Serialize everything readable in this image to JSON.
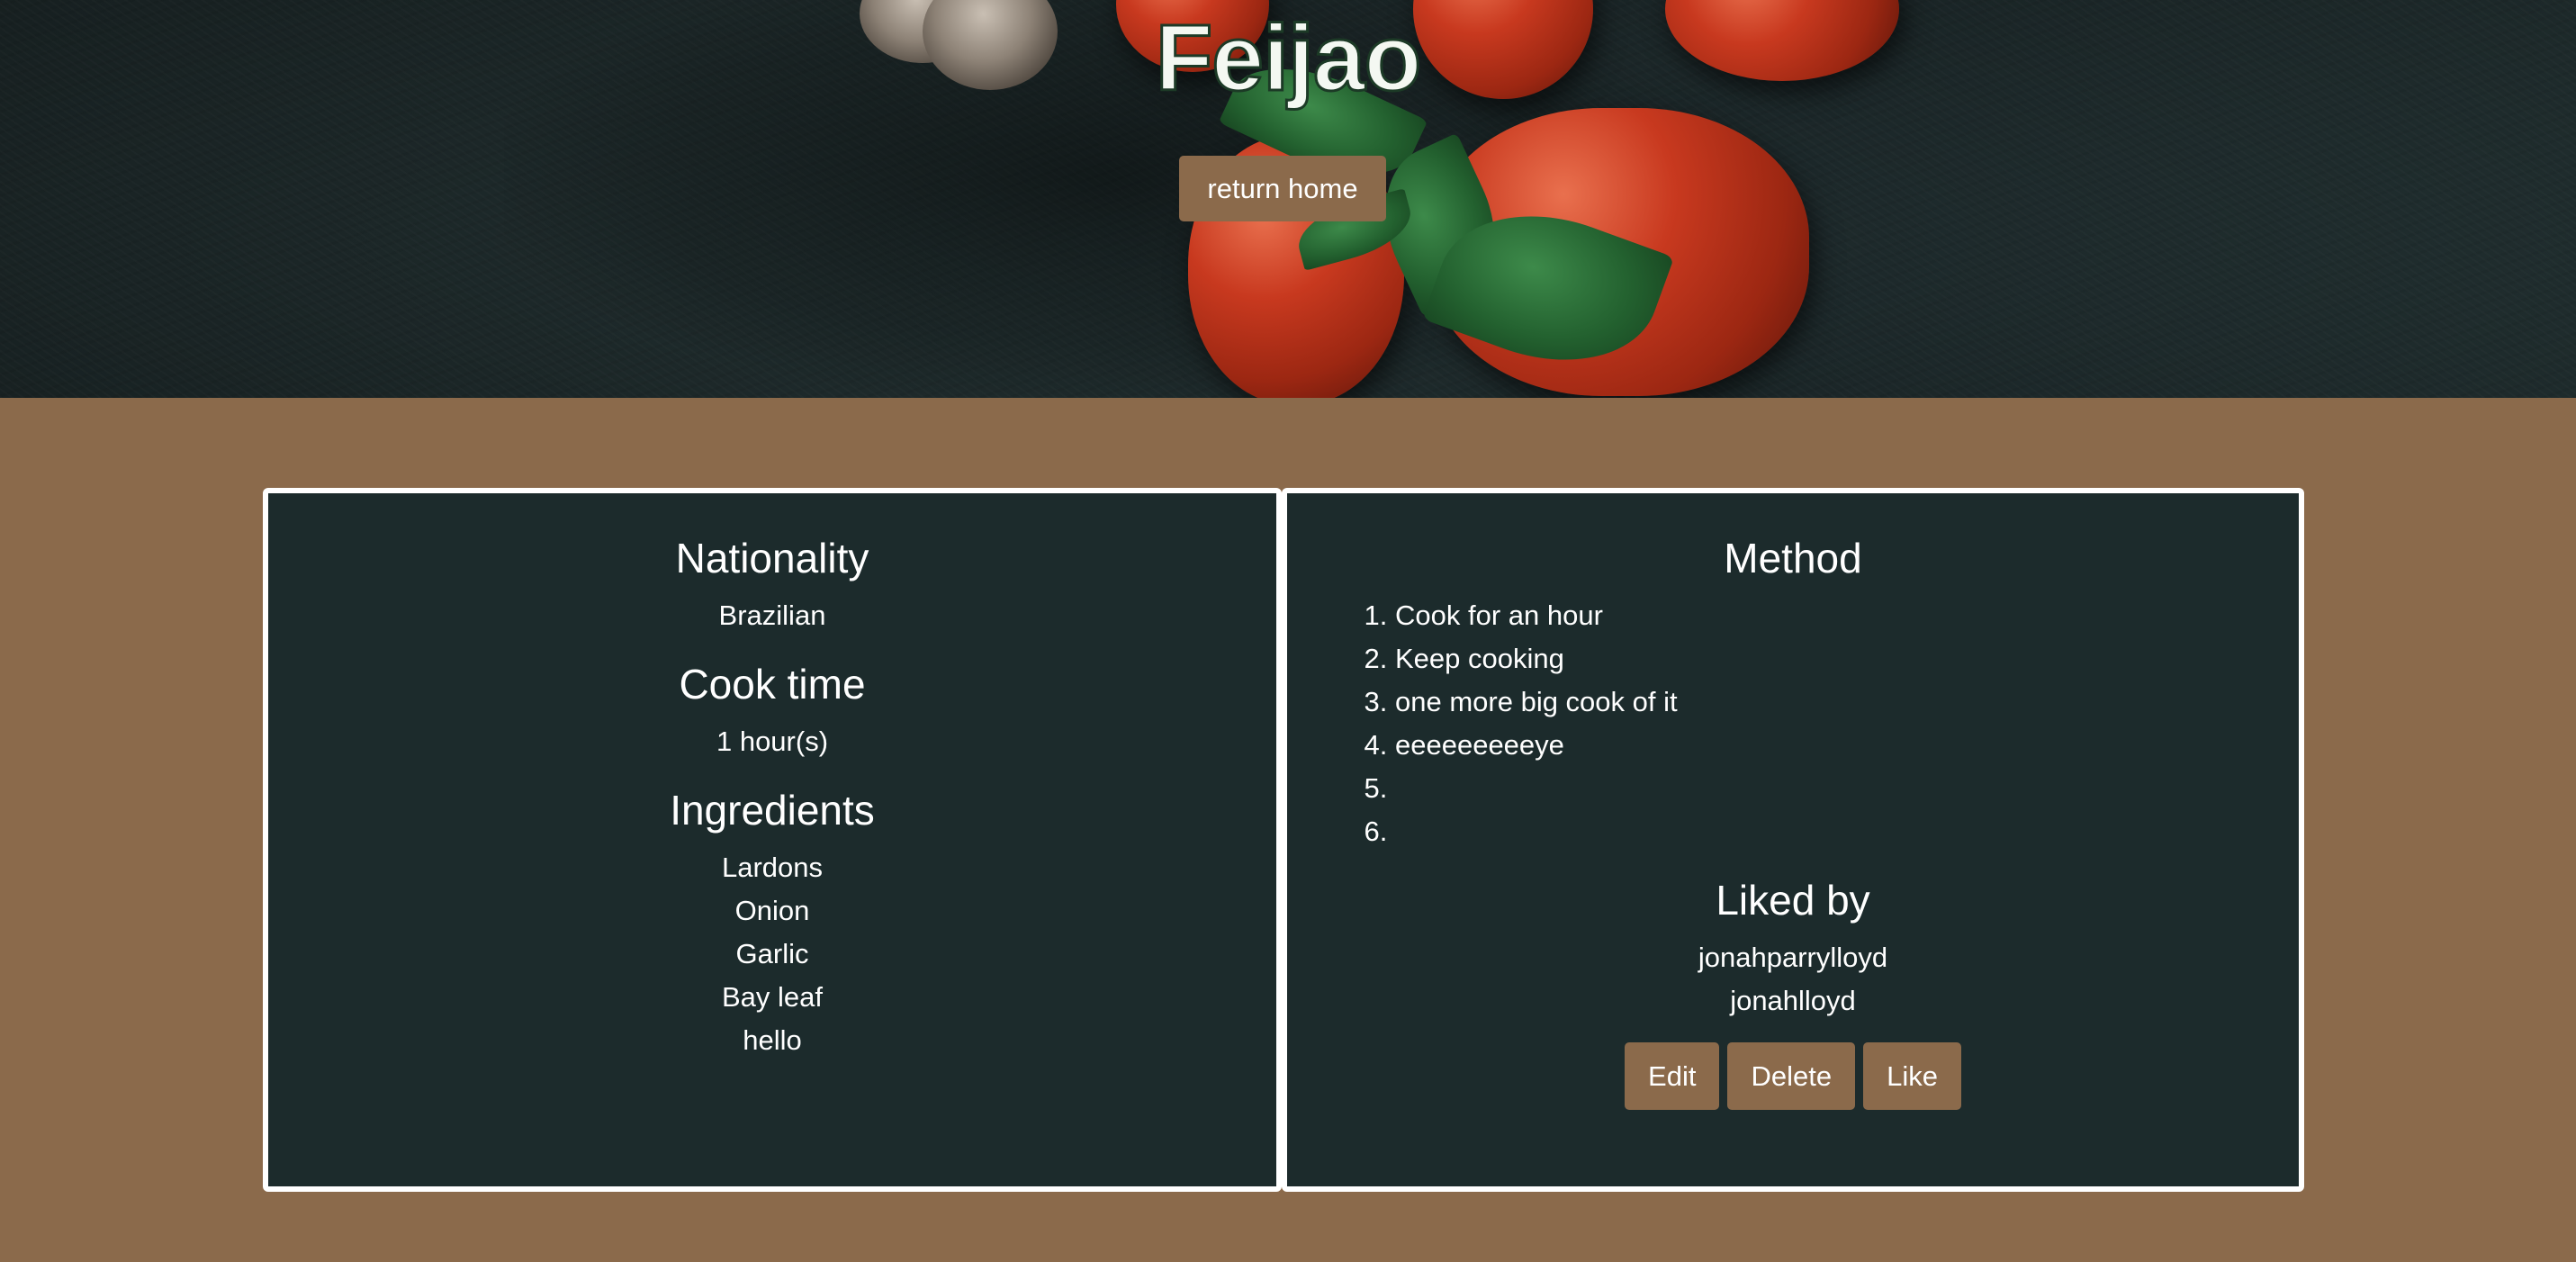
{
  "header": {
    "title": "Feijao",
    "return_home_label": "return home"
  },
  "details": {
    "nationality_title": "Nationality",
    "nationality": "Brazilian",
    "cook_time_title": "Cook time",
    "cook_time": "1 hour(s)",
    "ingredients_title": "Ingredients",
    "ingredients": [
      "Lardons",
      "Onion",
      "Garlic",
      "Bay leaf",
      "hello"
    ]
  },
  "method": {
    "title": "Method",
    "steps": [
      "Cook for an hour",
      "Keep cooking",
      "one more big cook of it",
      "eeeeeeeeeye",
      "",
      ""
    ]
  },
  "likes": {
    "title": "Liked by",
    "users": [
      "jonahparrylloyd",
      "jonahlloyd"
    ]
  },
  "actions": {
    "edit_label": "Edit",
    "delete_label": "Delete",
    "like_label": "Like"
  },
  "colors": {
    "page_background": "#8b6a4b",
    "card_background": "#1c2b2c",
    "button_background": "#8b6a4b",
    "card_border": "#ffffff"
  }
}
